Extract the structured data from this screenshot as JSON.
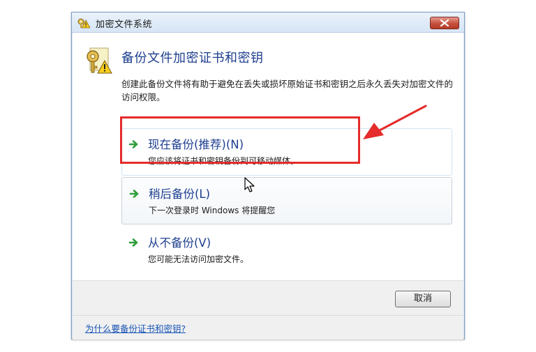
{
  "window": {
    "title": "加密文件系统",
    "close_icon": "close-icon"
  },
  "dialog": {
    "heading": "备份文件加密证书和密钥",
    "description": "创建此备份文件将有助于避免在丢失或损坏原始证书和密钥之后永久丢失对加密文件的访问权限。",
    "options": [
      {
        "label": "现在备份(推荐)(N)",
        "sub": "您应该将证书和密钥备份到可移动媒体。",
        "icon": "green-arrow-icon"
      },
      {
        "label": "稍后备份(L)",
        "sub": "下一次登录时 Windows 将提醒您",
        "icon": "green-arrow-icon"
      },
      {
        "label": "从不备份(V)",
        "sub": "您可能无法访问加密文件。",
        "icon": "green-arrow-icon"
      }
    ]
  },
  "buttons": {
    "cancel": "取消"
  },
  "footer": {
    "help_link": "为什么要备份证书和密钥?"
  },
  "colors": {
    "heading_blue": "#1e3f8f",
    "link_blue": "#1a56b6",
    "annotation_red": "#e52b2b",
    "arrow_green": "#2f9e3a"
  }
}
